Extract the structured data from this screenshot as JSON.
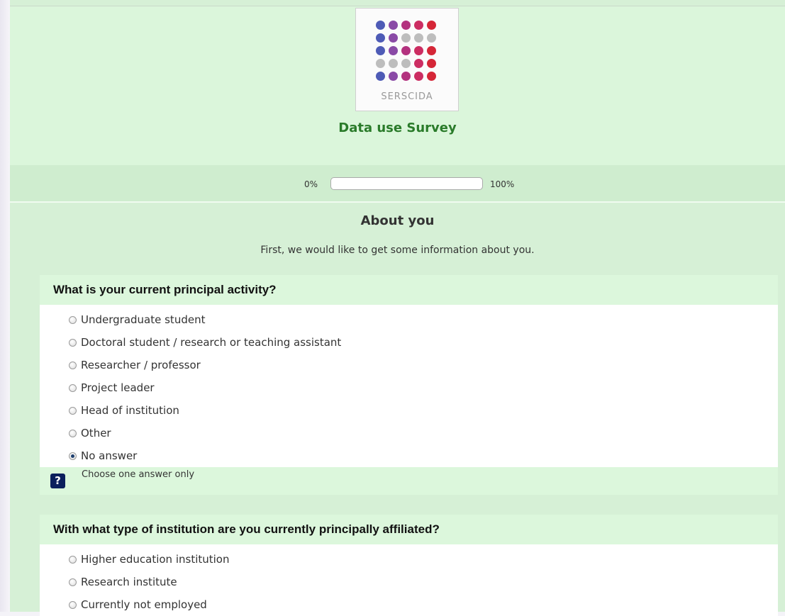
{
  "logo": {
    "text": "SERSCIDA",
    "colors": {
      "blue": "#4e5bb6",
      "purple": "#8a4aa6",
      "magenta": "#b3327f",
      "pink": "#cc2d62",
      "red": "#d52637",
      "grey": "#bdbdbd"
    }
  },
  "survey": {
    "title": "Data use Survey"
  },
  "progress": {
    "left_label": "0%",
    "right_label": "100%",
    "value_percent": 0
  },
  "group": {
    "title": "About you",
    "description": "First, we would like to get some information about you."
  },
  "questions": [
    {
      "text": "What is your current principal activity?",
      "options": [
        "Undergraduate student",
        "Doctoral student / research or teaching assistant",
        "Researcher / professor",
        "Project leader",
        "Head of institution",
        "Other",
        "No answer"
      ],
      "selected": "No answer",
      "help": "Choose one answer only"
    },
    {
      "text": "With what type of institution are you currently principally affiliated?",
      "options": [
        "Higher education institution",
        "Research institute",
        "Currently not employed"
      ]
    }
  ]
}
